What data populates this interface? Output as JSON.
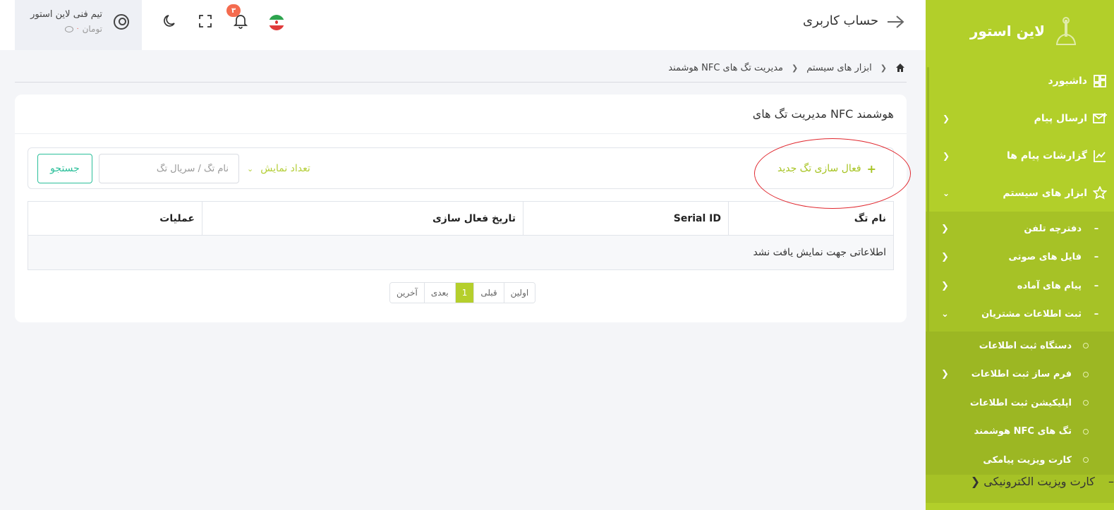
{
  "sidebar": {
    "brand": "لاین استور",
    "items": [
      {
        "label": "داشبورد",
        "icon": "dashboard-icon"
      },
      {
        "label": "ارسال پیام",
        "icon": "message-send-icon"
      },
      {
        "label": "گزارشات پیام ها",
        "icon": "chart-icon"
      },
      {
        "label": "ابزار های سیستم",
        "icon": "tools-icon"
      }
    ],
    "tools_sub": [
      {
        "label": "دفترچه تلفن"
      },
      {
        "label": "فایل های صوتی"
      },
      {
        "label": "پیام های آماده"
      },
      {
        "label": "ثبت اطلاعات مشتریان"
      }
    ],
    "customer_sub": [
      {
        "label": "دستگاه ثبت اطلاعات"
      },
      {
        "label": "فرم ساز ثبت اطلاعات"
      },
      {
        "label": "اپلیکیشن ثبت اطلاعات"
      },
      {
        "label": "تگ های NFC هوشمند"
      },
      {
        "label": "کارت ویزیت پیامکی"
      }
    ],
    "after": [
      {
        "label": "کارت ویزیت الکترونیکی"
      }
    ]
  },
  "header": {
    "title": "حساب کاربری",
    "user_name": "تیم فنی لاین استور",
    "balance_value": "۰",
    "balance_unit": "تومان",
    "notifications_count": "۳"
  },
  "breadcrumb": {
    "items": [
      "ابزار های سیستم",
      "مدیریت تگ های NFC هوشمند"
    ]
  },
  "card": {
    "title": "مدیریت تگ های NFC هوشمند",
    "activate_label": "فعال سازی تگ جدید",
    "count_label": "تعداد نمایش",
    "search_placeholder": "نام تگ / سریال تگ",
    "search_label": "جستجو"
  },
  "table": {
    "columns": [
      "نام تگ",
      "Serial ID",
      "تاریخ فعال سازی",
      "عملیات"
    ],
    "empty_message": "اطلاعاتی جهت نمایش یافت نشد"
  },
  "pagination": {
    "first": "اولین",
    "prev": "قبلی",
    "current": "1",
    "next": "بعدی",
    "last": "آخرین"
  },
  "colors": {
    "accent": "#b2cf2a",
    "search_button": "#2bbf9a",
    "annotation": "#e0272e"
  }
}
